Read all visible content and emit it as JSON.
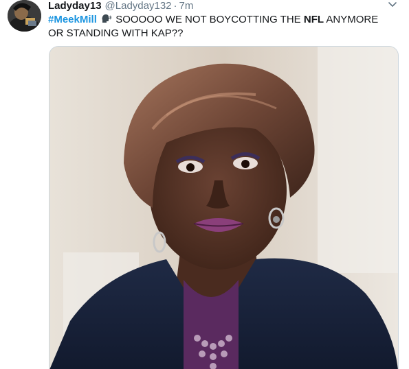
{
  "tweet": {
    "display_name": "Ladyday13",
    "handle": "@Ladyday132",
    "separator": "·",
    "time": "7m",
    "hashtag": "#MeekMill",
    "emoji": "speaking-head-icon",
    "text_before_bold": " SOOOOO WE NOT BOYCOTTING THE ",
    "bold_word": "NFL",
    "text_after_bold": " ANYMORE OR STANDING WITH KAP??"
  },
  "media": {
    "type": "image"
  },
  "colors": {
    "hashtag": "#1b95e0",
    "handle": "#657786",
    "text": "#14171a",
    "border": "#ccd6dd"
  }
}
